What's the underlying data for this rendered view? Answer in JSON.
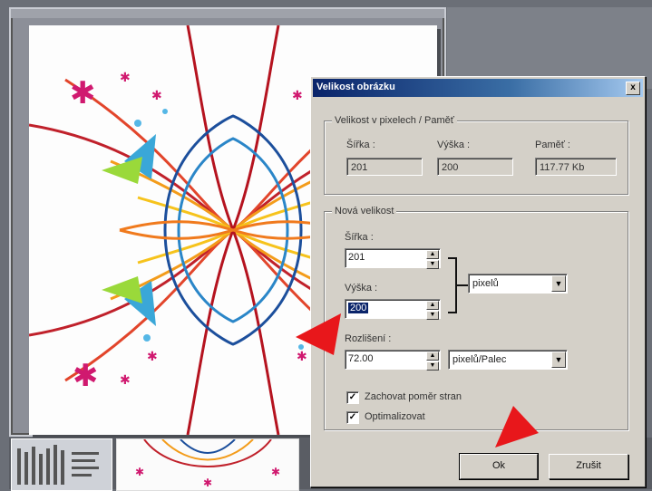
{
  "dialog": {
    "title": "Velikost obrázku",
    "close_label": "x",
    "pixels_group": {
      "legend": "Velikost v pixelech / Paměť",
      "width_label": "Šířka :",
      "width_value": "201",
      "height_label": "Výška :",
      "height_value": "200",
      "memory_label": "Paměť :",
      "memory_value": "117.77 Kb"
    },
    "new_size_group": {
      "legend": "Nová velikost",
      "width_label": "Šířka :",
      "width_value": "201",
      "height_label": "Výška :",
      "height_value": "200",
      "unit_selected": "pixelů",
      "resolution_label": "Rozlišení :",
      "resolution_value": "72.00",
      "resolution_unit_selected": "pixelů/Palec",
      "keep_ratio_label": "Zachovat poměr stran",
      "keep_ratio_checked": true,
      "optimize_label": "Optimalizovat",
      "optimize_checked": true
    },
    "ok_label": "Ok",
    "cancel_label": "Zrušit"
  },
  "icons": {
    "checkmark": "✓",
    "spin_up": "▲",
    "spin_down": "▼",
    "dropdown": "▼"
  },
  "colors": {
    "titlebar_start": "#0a246a",
    "dialog_face": "#d4d0c8",
    "annotation_arrow": "#e8171b"
  }
}
